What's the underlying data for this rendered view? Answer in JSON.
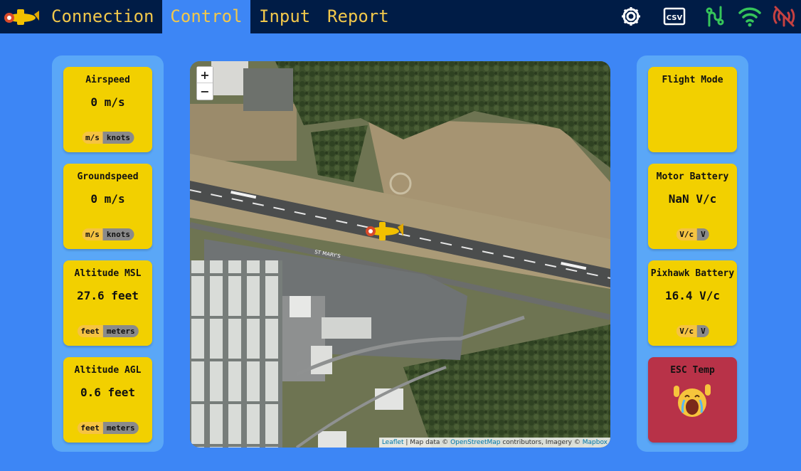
{
  "nav": {
    "tabs": [
      {
        "label": "Connection"
      },
      {
        "label": "Control"
      },
      {
        "label": "Input"
      },
      {
        "label": "Report"
      }
    ],
    "active_tab": "Control",
    "icons": [
      "settings-gear-icon",
      "csv-export-icon",
      "joystick-connected-icon",
      "wifi-icon",
      "signal-off-icon"
    ],
    "csv_label": "CSV"
  },
  "left_panel": {
    "cards": [
      {
        "title": "Airspeed",
        "value": "0 m/s",
        "toggle": [
          "m/s",
          "knots"
        ],
        "selected": "m/s"
      },
      {
        "title": "Groundspeed",
        "value": "0 m/s",
        "toggle": [
          "m/s",
          "knots"
        ],
        "selected": "m/s"
      },
      {
        "title": "Altitude MSL",
        "value": "27.6 feet",
        "toggle": [
          "feet",
          "meters"
        ],
        "selected": "feet"
      },
      {
        "title": "Altitude AGL",
        "value": "0.6 feet",
        "toggle": [
          "feet",
          "meters"
        ],
        "selected": "feet"
      }
    ]
  },
  "right_panel": {
    "cards": [
      {
        "title": "Flight Mode",
        "value": ""
      },
      {
        "title": "Motor Battery",
        "value": "NaN V/c",
        "toggle": [
          "V/c",
          "V"
        ],
        "selected": "V/c"
      },
      {
        "title": "Pixhawk Battery",
        "value": "16.4 V/c",
        "toggle": [
          "V/c",
          "V"
        ],
        "selected": "V/c"
      },
      {
        "title": "ESC Temp",
        "icon": "crying-face-icon"
      }
    ]
  },
  "map": {
    "zoom_in": "+",
    "zoom_out": "−",
    "runway_label": "ST MARY'S",
    "attribution": {
      "leaflet": "Leaflet",
      "sep1": " | Map data © ",
      "osm": "OpenStreetMap",
      "sep2": " contributors, Imagery © ",
      "mapbox": "Mapbox"
    }
  },
  "colors": {
    "topbar": "#001c46",
    "background": "#3d86f5",
    "panel": "#5aa7f7",
    "card": "#f2d000",
    "card_alert": "#b83248",
    "tab_text": "#f2c84b",
    "toggle_on": "#f6c342",
    "toggle_off": "#8a8a8a"
  }
}
